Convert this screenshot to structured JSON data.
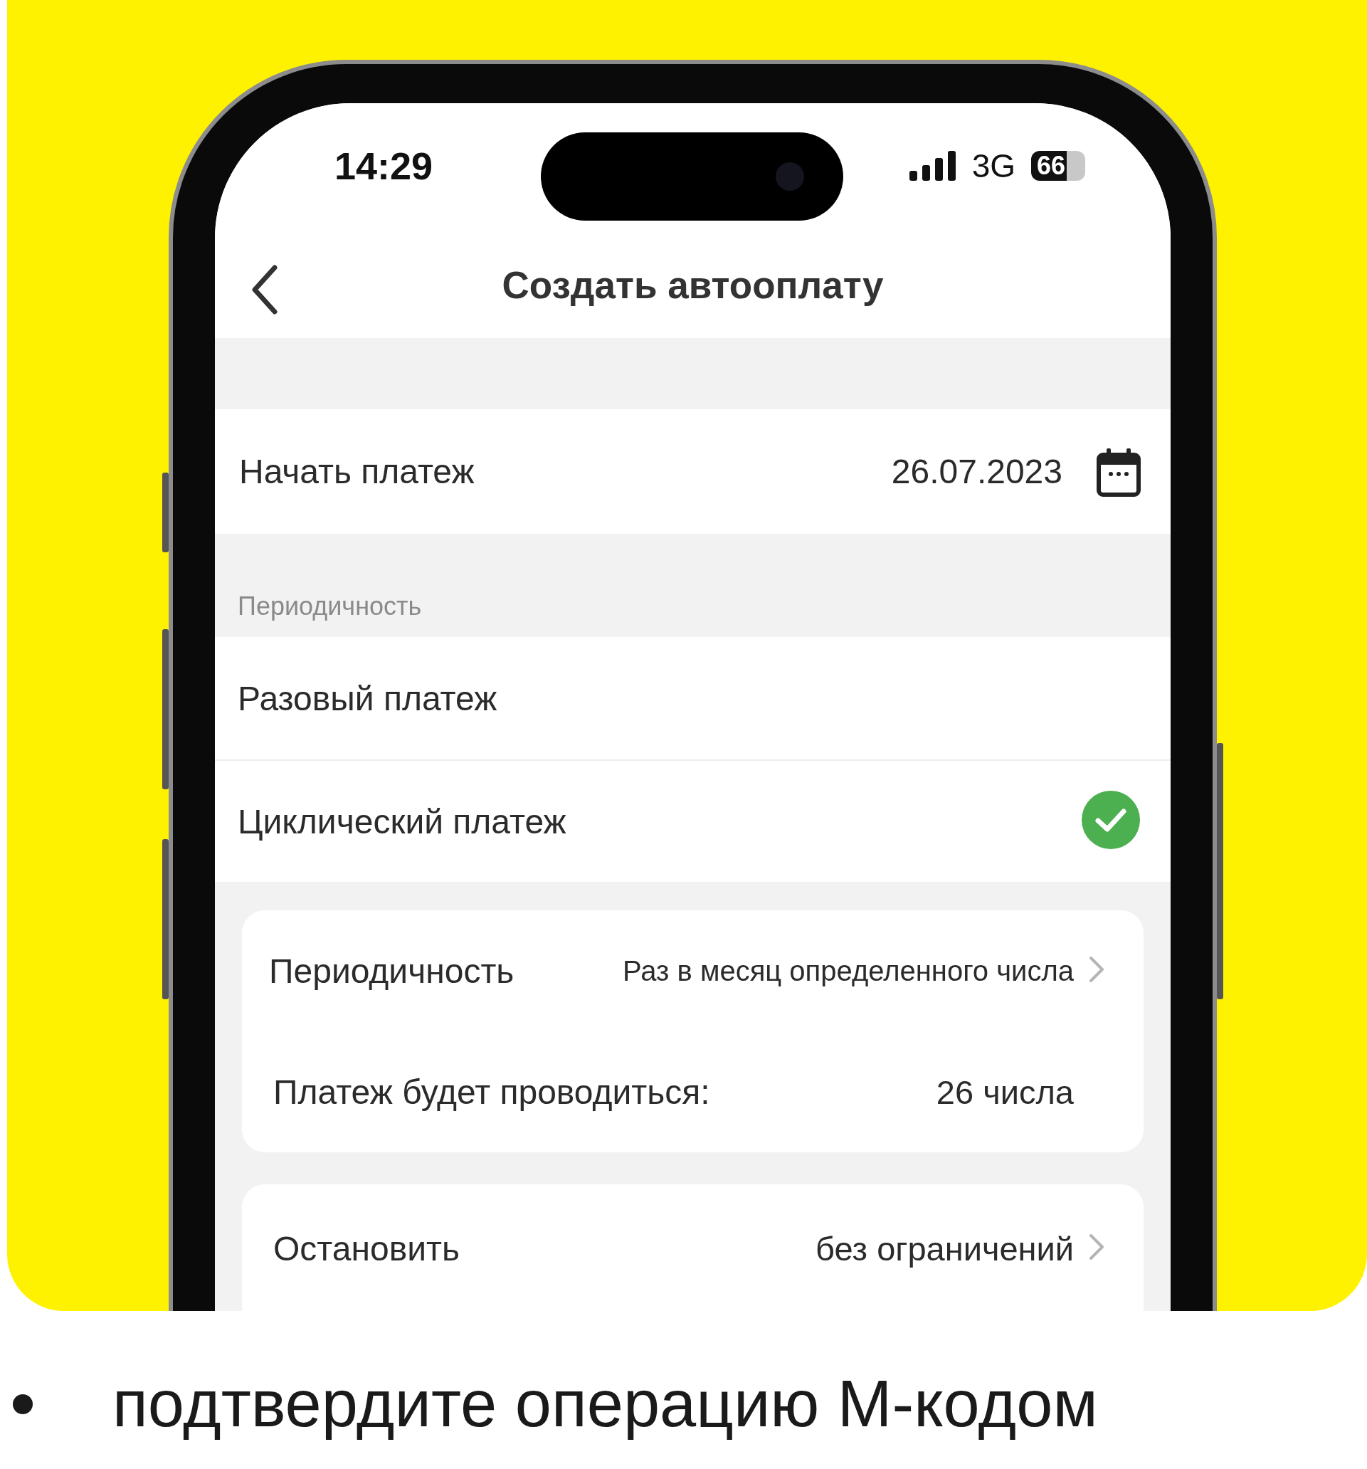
{
  "status_bar": {
    "time": "14:29",
    "network": "3G",
    "battery": "66"
  },
  "nav": {
    "title": "Создать автооплату"
  },
  "start": {
    "label": "Начать платеж",
    "date": "26.07.2023"
  },
  "periodicity_section": {
    "header": "Периодичность",
    "options": [
      {
        "label": "Разовый платеж",
        "selected": false
      },
      {
        "label": "Циклический платеж",
        "selected": true
      }
    ]
  },
  "schedule_card": {
    "rows": [
      {
        "kind": "link",
        "label": "Периодичность",
        "value": "Раз в месяц определенного числа"
      },
      {
        "kind": "info",
        "label": "Платеж будет проводиться:",
        "value": "26 числа"
      }
    ]
  },
  "stop_card": {
    "label": "Остановить",
    "value": "без ограничений"
  },
  "note": {
    "text": "подтвердите операцию М-кодом"
  }
}
